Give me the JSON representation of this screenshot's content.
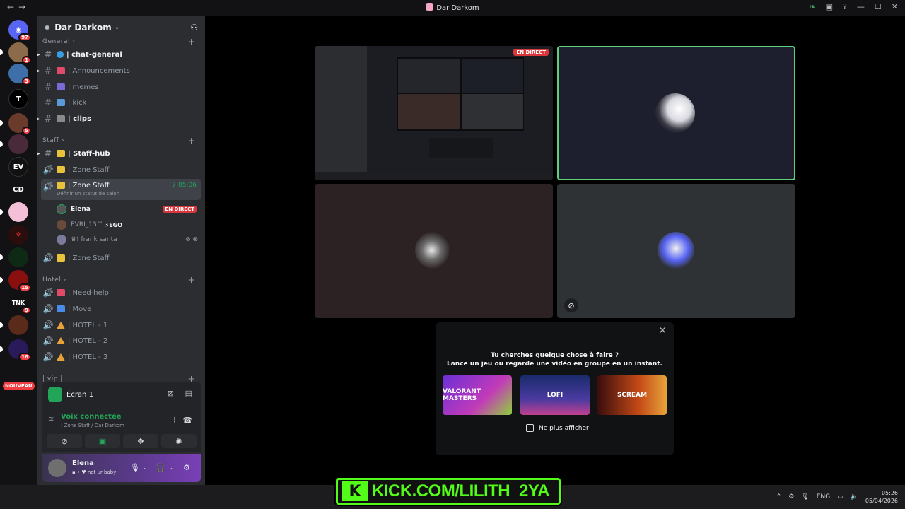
{
  "window": {
    "title": "Dar Darkom"
  },
  "server": {
    "name": "Dar Darkom"
  },
  "rail": {
    "badges": [
      "97",
      "1",
      "3",
      "5",
      "15",
      "9",
      "16"
    ],
    "text_icon": "CD",
    "nouveau": "NOUVEAU"
  },
  "categories": {
    "general": "General",
    "staff": "Staff",
    "hotel": "Hotel",
    "vip": "| vip |"
  },
  "channels": {
    "chat_general": "| chat-general",
    "announcements": "| Announcements",
    "memes": "| memes",
    "kick": "| kick",
    "clips": "| clips",
    "staff_hub": "| Staff-hub",
    "zone_staff_1": "| Zone Staff",
    "zone_staff_active": "| Zone Staff",
    "zone_staff_time": "7:05:06",
    "zone_staff_status": "Définir un statut de salon",
    "zone_staff_3": "| Zone Staff",
    "need_help": "| Need-help",
    "move": "| Move",
    "hotel1": "| HOTEL - 1",
    "hotel2": "| HOTEL - 2",
    "hotel3": "| HOTEL - 3"
  },
  "voice_users": [
    {
      "name": "Elena",
      "live": "EN DIRECT"
    },
    {
      "name": "EVRI_13™",
      "tag": "EGO"
    },
    {
      "name": "♛! frank santa"
    }
  ],
  "screen_panel": {
    "label": "Écran 1"
  },
  "voice_panel": {
    "status": "Voix connectée",
    "location": "| Zone Staff / Dar Darkom"
  },
  "user_panel": {
    "name": "Elena",
    "status": "not ur baby"
  },
  "stage": {
    "live_tag": "EN DIRECT"
  },
  "prompt": {
    "line1": "Tu cherches quelque chose à faire ?",
    "line2": "Lance un jeu ou regarde une vidéo en groupe en un instant.",
    "activities": [
      "VALORANT MASTERS",
      "LOFI",
      "SCREAM"
    ],
    "checkbox_label": "Ne plus afficher"
  },
  "overlay": {
    "kick_text": "KICK.COM/LILITH_2YA"
  },
  "tray": {
    "lang": "ENG",
    "time": "05:26",
    "date": "05/04/2026"
  },
  "colors": {
    "accent_green": "#23a559",
    "live_red": "#da373c",
    "kick_green": "#53fc18"
  }
}
